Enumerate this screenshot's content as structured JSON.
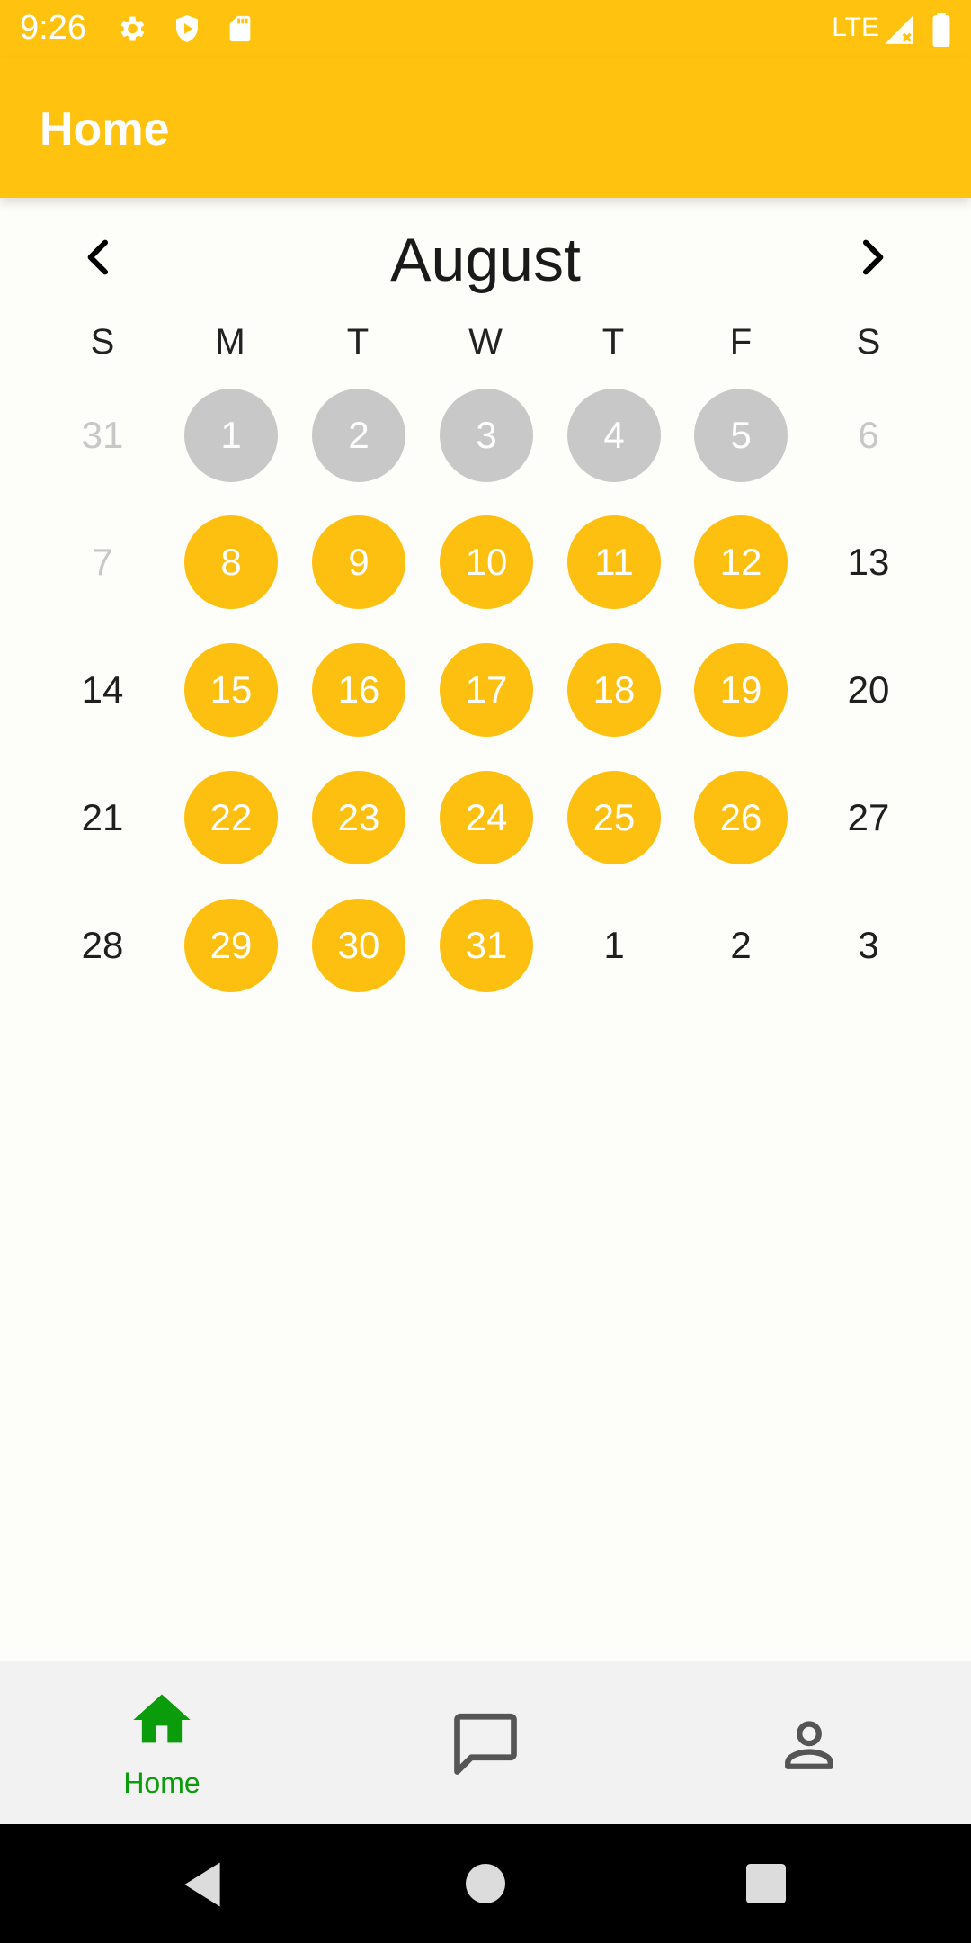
{
  "status_bar": {
    "time": "9:26",
    "network": "LTE",
    "icons": [
      "settings-icon",
      "shield-icon",
      "sd-card-icon",
      "signal-icon",
      "battery-icon"
    ]
  },
  "app_bar": {
    "title": "Home"
  },
  "calendar": {
    "month": "August",
    "weekdays": [
      "S",
      "M",
      "T",
      "W",
      "T",
      "F",
      "S"
    ],
    "weeks": [
      [
        "31",
        "1",
        "2",
        "3",
        "4",
        "5",
        "6"
      ],
      [
        "7",
        "8",
        "9",
        "10",
        "11",
        "12",
        "13"
      ],
      [
        "14",
        "15",
        "16",
        "17",
        "18",
        "19",
        "20"
      ],
      [
        "21",
        "22",
        "23",
        "24",
        "25",
        "26",
        "27"
      ],
      [
        "28",
        "29",
        "30",
        "31",
        "1",
        "2",
        "3"
      ]
    ],
    "states": [
      [
        "other",
        "past",
        "past",
        "past",
        "past",
        "past",
        "other"
      ],
      [
        "other",
        "sel",
        "sel",
        "sel",
        "sel",
        "sel",
        "normal"
      ],
      [
        "normal",
        "sel",
        "sel",
        "sel",
        "sel",
        "sel",
        "normal"
      ],
      [
        "normal",
        "sel",
        "sel",
        "sel",
        "sel",
        "sel",
        "normal"
      ],
      [
        "normal",
        "sel",
        "sel",
        "sel",
        "normal",
        "normal",
        "normal"
      ]
    ]
  },
  "bottom_nav": {
    "items": [
      {
        "label": "Home",
        "icon": "home-icon",
        "active": true
      },
      {
        "label": "",
        "icon": "chat-icon",
        "active": false
      },
      {
        "label": "",
        "icon": "profile-icon",
        "active": false
      }
    ]
  },
  "colors": {
    "accent": "#FFC20E",
    "selected_day": "#FDBF10",
    "past_day": "#C8C8C8",
    "nav_active": "#0B9C0B"
  }
}
